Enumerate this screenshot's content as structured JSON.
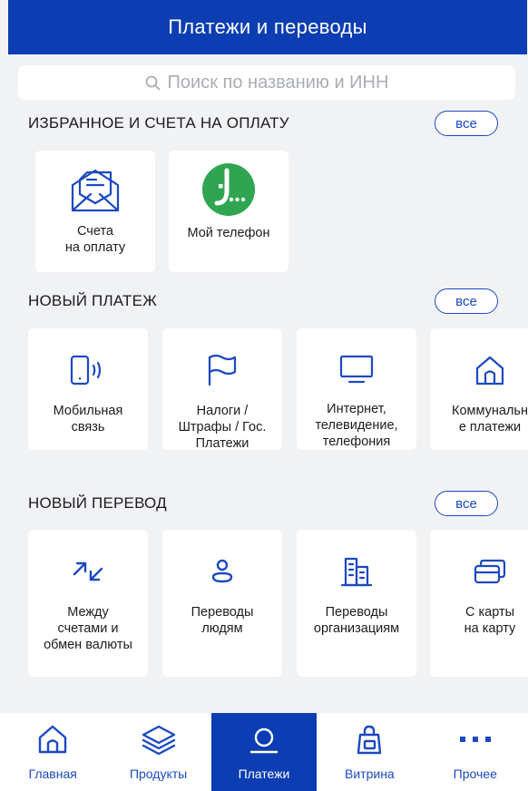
{
  "header": {
    "title": "Платежи и переводы"
  },
  "search": {
    "placeholder": "Поиск по названию и ИНН"
  },
  "favorites": {
    "title": "ИЗБРАННОЕ И СЧЕТА НА ОПЛАТУ",
    "all_label": "все",
    "items": [
      {
        "label": "Счета\nна оплату",
        "icon": "envelope-document-icon"
      },
      {
        "label": "Мой телефон",
        "icon": "megafon-logo-icon"
      }
    ]
  },
  "new_payment": {
    "title": "НОВЫЙ ПЛАТЕЖ",
    "all_label": "все",
    "items": [
      {
        "label": "Мобильная\nсвязь",
        "icon": "mobile-phone-icon"
      },
      {
        "label": "Налоги /\nШтрафы / Гос.\nПлатежи",
        "icon": "flag-icon"
      },
      {
        "label": "Интернет,\nтелевидение,\nтелефония",
        "icon": "monitor-icon"
      },
      {
        "label": "Коммунальн\nе платежи",
        "icon": "house-icon"
      }
    ]
  },
  "new_transfer": {
    "title": "НОВЫЙ ПЕРЕВОД",
    "all_label": "все",
    "items": [
      {
        "label": "Между\nсчетами и\nобмен валюты",
        "icon": "exchange-arrows-icon"
      },
      {
        "label": "Переводы\nлюдям",
        "icon": "person-icon"
      },
      {
        "label": "Переводы\nорганизациям",
        "icon": "building-icon"
      },
      {
        "label": "С карты\nна карту",
        "icon": "cards-icon"
      }
    ]
  },
  "tabbar": {
    "items": [
      {
        "label": "Главная",
        "icon": "home-icon"
      },
      {
        "label": "Продукты",
        "icon": "layers-icon"
      },
      {
        "label": "Платежи",
        "icon": "payments-icon",
        "active": true
      },
      {
        "label": "Витрина",
        "icon": "shopping-bag-icon"
      },
      {
        "label": "Прочее",
        "icon": "more-dots-icon"
      }
    ]
  },
  "colors": {
    "brand_blue": "#0c3db2",
    "accent_blue": "#1c49c2",
    "megafon_green": "#2fa552",
    "background": "#f1f2f4"
  }
}
